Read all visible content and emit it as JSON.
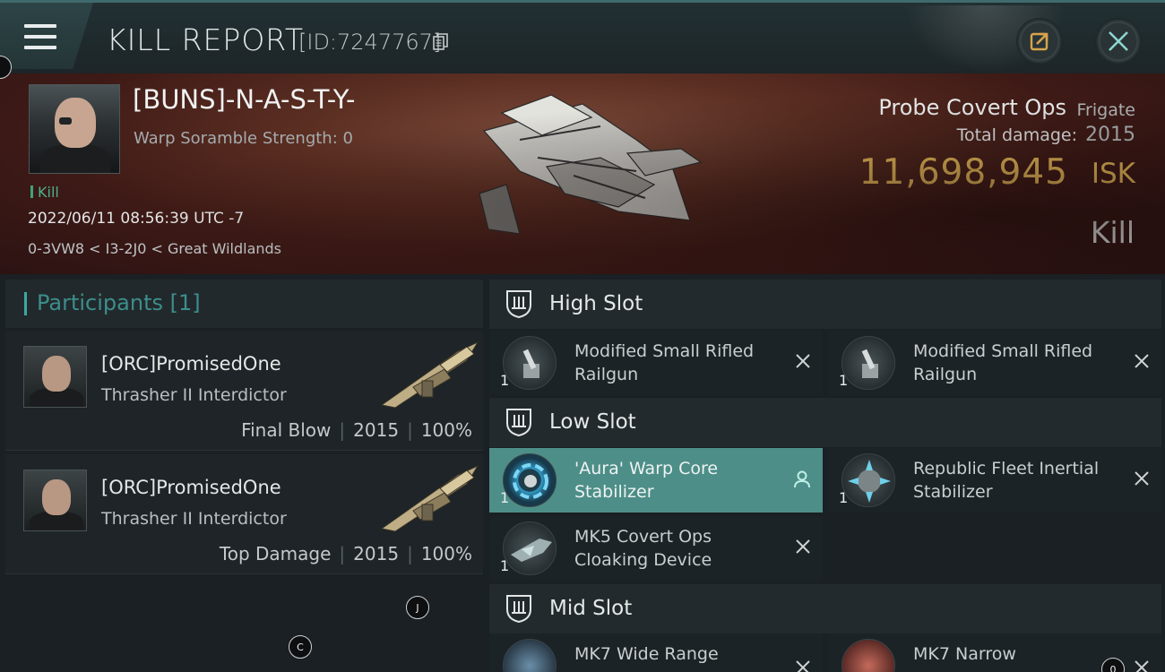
{
  "header": {
    "title": "KILL REPORT",
    "report_id": "[ID:7247767]",
    "icons": [
      "menu-icon",
      "copy-icon",
      "share-icon",
      "close-icon"
    ]
  },
  "victim": {
    "name": "[BUNS]-N-A-S-T-Y-",
    "warp_scramble": "Warp Soramble Strength: 0",
    "kill_tag": "Kill",
    "timestamp": "2022/06/11 08:56:39 UTC -7",
    "location": "0-3VW8 < I3-2J0 < Great Wildlands",
    "ship_name": "Probe Covert Ops",
    "ship_class": "Frigate",
    "damage_label": "Total damage:",
    "damage_value": "2015",
    "isk_value": "11,698,945",
    "isk_unit": "ISK",
    "result": "Kill"
  },
  "participants": {
    "title": "Participants [1]",
    "list": [
      {
        "name": "[ORC]PromisedOne",
        "ship": "Thrasher II Interdictor",
        "role": "Final Blow",
        "damage": "2015",
        "percent": "100%"
      },
      {
        "name": "[ORC]PromisedOne",
        "ship": "Thrasher II Interdictor",
        "role": "Top Damage",
        "damage": "2015",
        "percent": "100%"
      }
    ]
  },
  "slots": {
    "high": {
      "title": "High Slot",
      "items": [
        {
          "qty": "1",
          "name": "Modified Small Rifled Railgun"
        },
        {
          "qty": "1",
          "name": "Modified Small Rifled Railgun"
        }
      ]
    },
    "low": {
      "title": "Low Slot",
      "items": [
        {
          "qty": "1",
          "name": "'Aura' Warp Core Stabilizer",
          "selected": true
        },
        {
          "qty": "1",
          "name": "Republic Fleet Inertial Stabilizer"
        },
        {
          "qty": "1",
          "name": "MK5 Covert Ops Cloaking Device"
        }
      ]
    },
    "mid": {
      "title": "Mid Slot",
      "items": [
        {
          "qty": "",
          "name": "MK7 Wide Range"
        },
        {
          "qty": "",
          "name": "MK7 Narrow"
        }
      ]
    }
  },
  "hotkeys": [
    "J",
    "C",
    "0"
  ],
  "colors": {
    "accent_teal": "#3ea7a0",
    "isk_gold": "#f2c35c",
    "selected_item": "#4d8e88",
    "kill_green": "#4bb08a"
  }
}
